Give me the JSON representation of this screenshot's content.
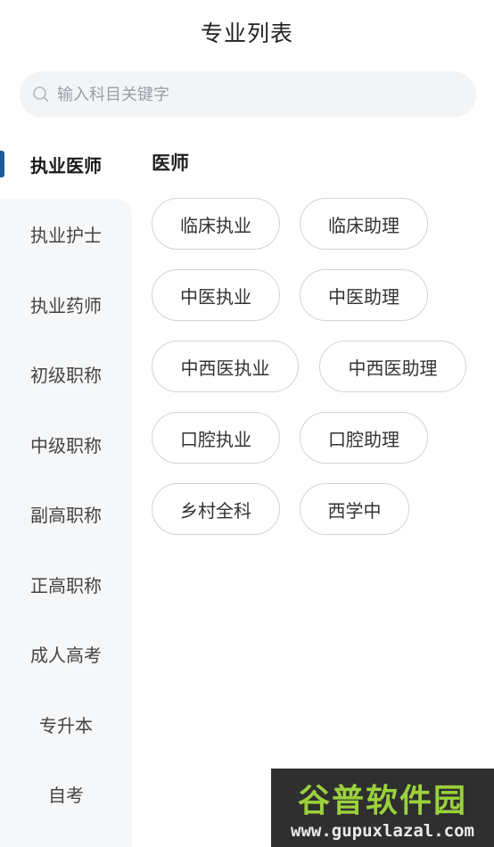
{
  "header": {
    "title": "专业列表"
  },
  "search": {
    "placeholder": "输入科目关键字"
  },
  "sidebar": {
    "items": [
      {
        "label": "执业医师",
        "active": true
      },
      {
        "label": "执业护士"
      },
      {
        "label": "执业药师"
      },
      {
        "label": "初级职称"
      },
      {
        "label": "中级职称"
      },
      {
        "label": "副高职称"
      },
      {
        "label": "正高职称"
      },
      {
        "label": "成人高考"
      },
      {
        "label": "专升本"
      },
      {
        "label": "自考"
      }
    ]
  },
  "main": {
    "section_title": "医师",
    "chips": [
      "临床执业",
      "临床助理",
      "中医执业",
      "中医助理",
      "中西医执业",
      "中西医助理",
      "口腔执业",
      "口腔助理",
      "乡村全科",
      "西学中"
    ]
  },
  "watermark": {
    "brand": "谷普软件园",
    "url": "www.gupuxlazal.com"
  },
  "colors": {
    "accent_bar": "#1a5c9c",
    "sidebar_bg": "#f6f7f8",
    "chip_border": "#cfd3d8"
  }
}
